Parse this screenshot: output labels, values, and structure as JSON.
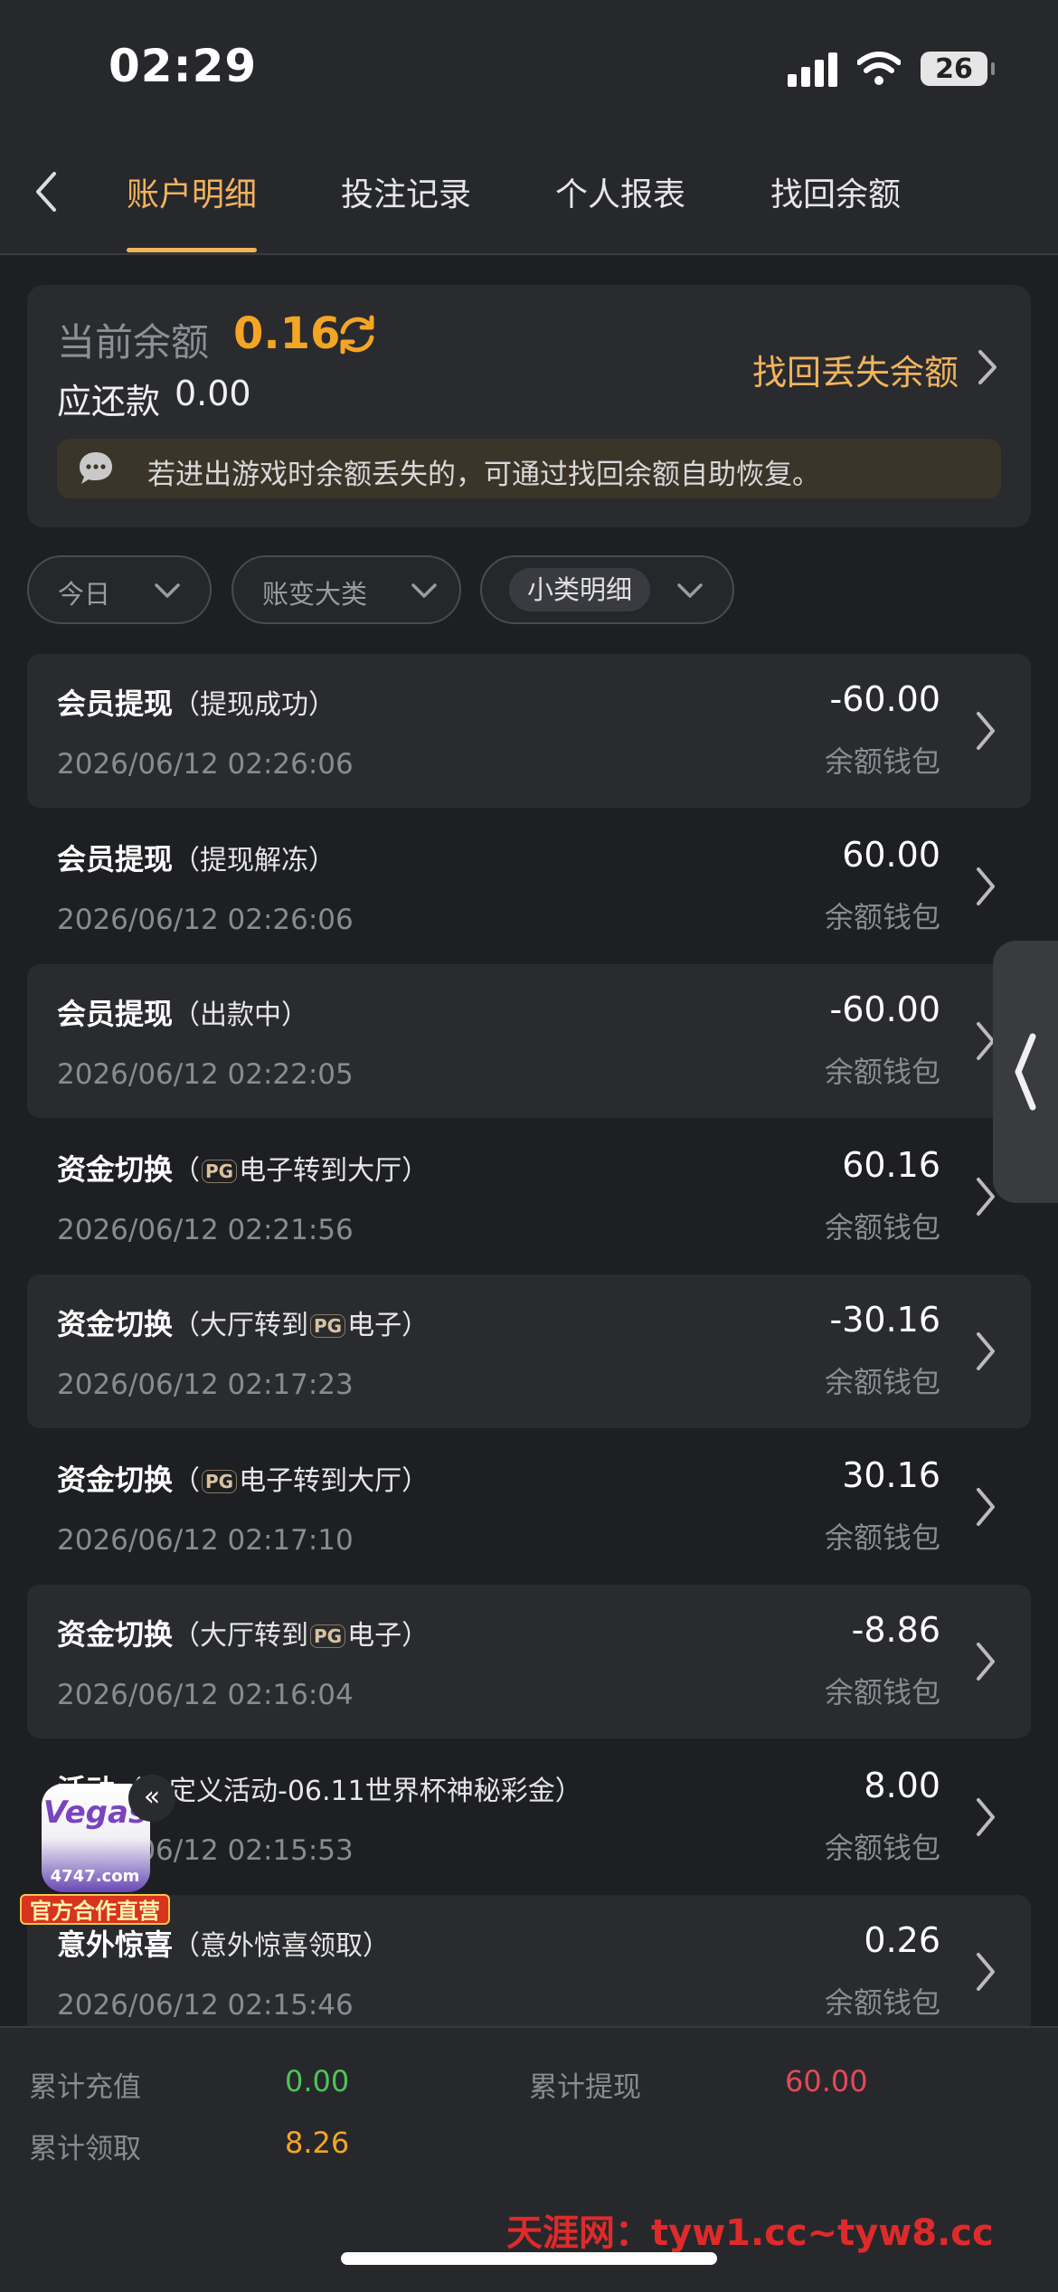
{
  "status": {
    "time": "02:29",
    "battery": "26"
  },
  "nav": {
    "tabs": [
      "账户明细",
      "投注记录",
      "个人报表",
      "找回余额"
    ]
  },
  "balance": {
    "label": "当前余额",
    "value": "0.16",
    "owe_label": "应还款",
    "owe_value": "0.00",
    "recover_link": "找回丢失余额",
    "tip": "若进出游戏时余额丢失的，可通过找回余额自助恢复。"
  },
  "filters": [
    "今日",
    "账变大类",
    "小类明细"
  ],
  "pg_logo": "PG",
  "transactions": [
    {
      "type": "会员提现",
      "detail": "（提现成功）",
      "date": "2026/06/12 02:26:06",
      "amount": "-60.00",
      "wallet": "余额钱包"
    },
    {
      "type": "会员提现",
      "detail": "（提现解冻）",
      "date": "2026/06/12 02:26:06",
      "amount": "60.00",
      "wallet": "余额钱包"
    },
    {
      "type": "会员提现",
      "detail": "（出款中）",
      "date": "2026/06/12 02:22:05",
      "amount": "-60.00",
      "wallet": "余额钱包"
    },
    {
      "type": "资金切换",
      "detail_pre": "（",
      "detail_post": "电子转到大厅）",
      "date": "2026/06/12 02:21:56",
      "amount": "60.16",
      "wallet": "余额钱包"
    },
    {
      "type": "资金切换",
      "detail_pre": "（大厅转到",
      "detail_post": "电子）",
      "date": "2026/06/12 02:17:23",
      "amount": "-30.16",
      "wallet": "余额钱包"
    },
    {
      "type": "资金切换",
      "detail_pre": "（",
      "detail_post": "电子转到大厅）",
      "date": "2026/06/12 02:17:10",
      "amount": "30.16",
      "wallet": "余额钱包"
    },
    {
      "type": "资金切换",
      "detail_pre": "（大厅转到",
      "detail_post": "电子）",
      "date": "2026/06/12 02:16:04",
      "amount": "-8.86",
      "wallet": "余额钱包"
    },
    {
      "type": "活动",
      "detail": "（自定义活动-06.11世界杯神秘彩金）",
      "date": "2026/06/12 02:15:53",
      "amount": "8.00",
      "wallet": "余额钱包"
    },
    {
      "type": "意外惊喜",
      "detail": "（意外惊喜领取）",
      "date": "2026/06/12 02:15:46",
      "amount": "0.26",
      "wallet": "余额钱包"
    }
  ],
  "ad": {
    "brand": "Vegas",
    "domain": "4747.com",
    "badge": "官方合作直营",
    "close": "«"
  },
  "footer": {
    "deposit_label": "累计充值",
    "deposit_value": "0.00",
    "withdraw_label": "累计提现",
    "withdraw_value": "60.00",
    "claim_label": "累计领取",
    "claim_value": "8.26"
  },
  "watermark": "天涯网：tyw1.cc~tyw8.cc",
  "colors": {
    "accent": "#f1b35d",
    "balance": "#f5a524",
    "deposit": "#4cc45a",
    "withdraw": "#e24a5a",
    "claim": "#f5a524"
  }
}
